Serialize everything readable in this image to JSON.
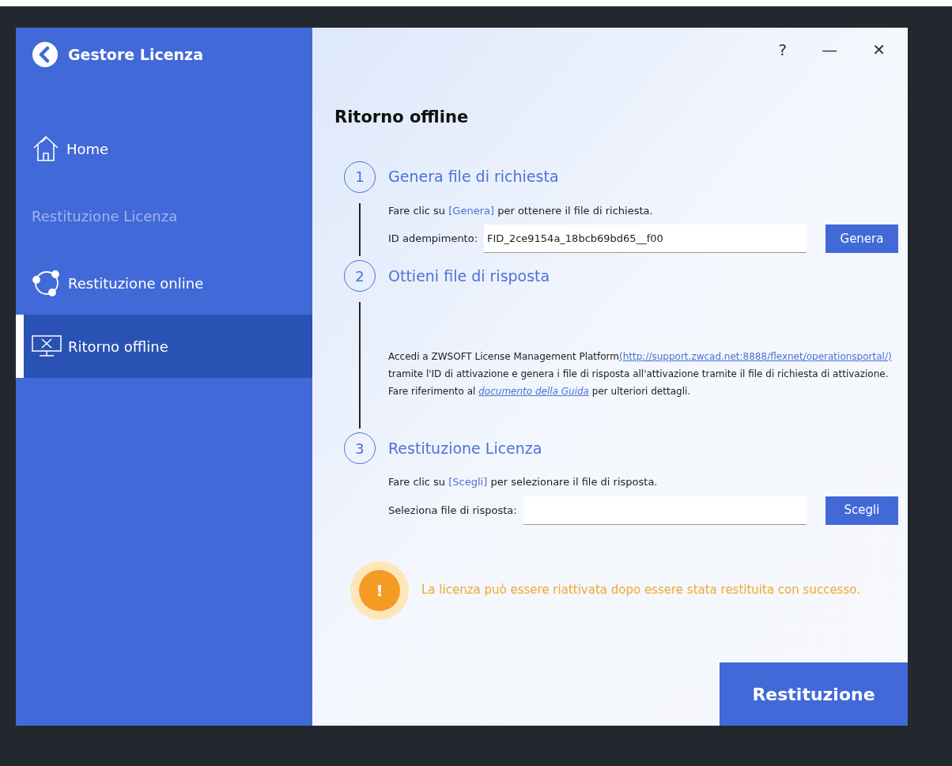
{
  "sidebar": {
    "title": "Gestore Licenza",
    "items": [
      {
        "kind": "home",
        "label": "Home",
        "selected": false
      },
      {
        "kind": "heading",
        "label": "Restituzione Licenza"
      },
      {
        "kind": "online",
        "label": "Restituzione online",
        "selected": false
      },
      {
        "kind": "offline",
        "label": "Ritorno offline",
        "selected": true
      }
    ]
  },
  "window_controls": [
    "?",
    "—",
    "✕"
  ],
  "page_title": "Ritorno offline",
  "steps": [
    {
      "number": "1",
      "title": "Genera file di richiesta",
      "instruction": {
        "before": "Fare clic su ",
        "highlight": "[Genera]",
        "after": " per ottenere il file di richiesta."
      },
      "field": {
        "label": "ID adempimento:",
        "value": "FID_2ce9154a_18bcb69bd65__f00"
      },
      "button": "Genera"
    },
    {
      "number": "2",
      "title": "Ottieni file di risposta",
      "paragraph": [
        {
          "kind": "text",
          "text": "Accedi a ZWSOFT License Management Platform"
        },
        {
          "kind": "link",
          "text": "(http://support.zwcad.net:8888/flexnet/operationsportal/)"
        },
        {
          "kind": "text",
          "text": " tramite l'ID di attivazione e genera i file di risposta all'attivazione tramite il file di richiesta di attivazione. Fare riferimento al "
        },
        {
          "kind": "italic-link",
          "text": "documento della Guida"
        },
        {
          "kind": "text",
          "text": " per ulteriori dettagli."
        }
      ]
    },
    {
      "number": "3",
      "title": "Restituzione Licenza",
      "instruction": {
        "before": "Fare clic su ",
        "highlight": "[Scegli]",
        "after": " per selezionare il file di risposta."
      },
      "field": {
        "label": "Seleziona file di risposta:"
      },
      "button": "Scegli"
    }
  ],
  "warning": {
    "icon_text": "!",
    "text": "La licenza può essere riattivata dopo essere stata restituita con successo."
  },
  "primary_button": "Restituzione"
}
